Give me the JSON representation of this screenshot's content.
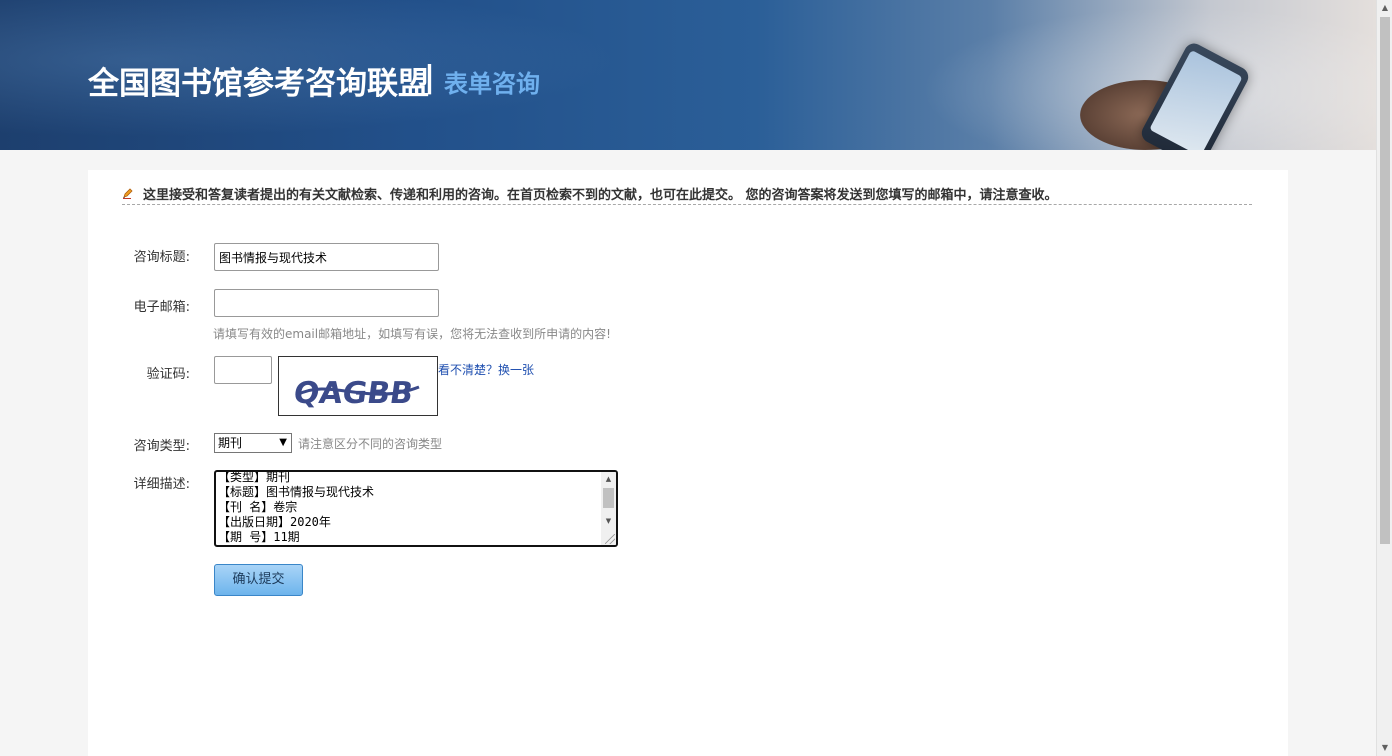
{
  "banner": {
    "title": "全国图书馆参考咨询联盟",
    "separator": "|",
    "subtitle": "表单咨询"
  },
  "notice": {
    "text": "这里接受和答复读者提出的有关文献检索、传递和利用的咨询。在首页检索不到的文献，也可在此提交。  您的咨询答案将发送到您填写的邮箱中，请注意查收。"
  },
  "form": {
    "title_label": "咨询标题:",
    "title_value": "图书情报与现代技术",
    "email_label": "电子邮箱:",
    "email_value": "",
    "email_hint": "请填写有效的email邮箱地址，如填写有误，您将无法查收到所申请的内容!",
    "captcha_label": "验证码:",
    "captcha_value": "",
    "captcha_text": "QAGBB",
    "captcha_refresh": "看不清楚？换一张",
    "type_label": "咨询类型:",
    "type_selected": "期刊",
    "type_hint": "请注意区分不同的咨询类型",
    "detail_label": "详细描述:",
    "detail_lines": [
      "【类型】期刊",
      "【标题】图书情报与现代技术",
      "【刊 名】卷宗",
      "【出版日期】2020年",
      "【期 号】11期"
    ],
    "submit_label": "确认提交"
  },
  "colors": {
    "banner_subtitle": "#6fb0ee",
    "link": "#2050b0",
    "button": "#6db4ec"
  },
  "icons": {
    "notice_icon": "pencil-icon",
    "select_arrow": "chevron-down-icon"
  }
}
